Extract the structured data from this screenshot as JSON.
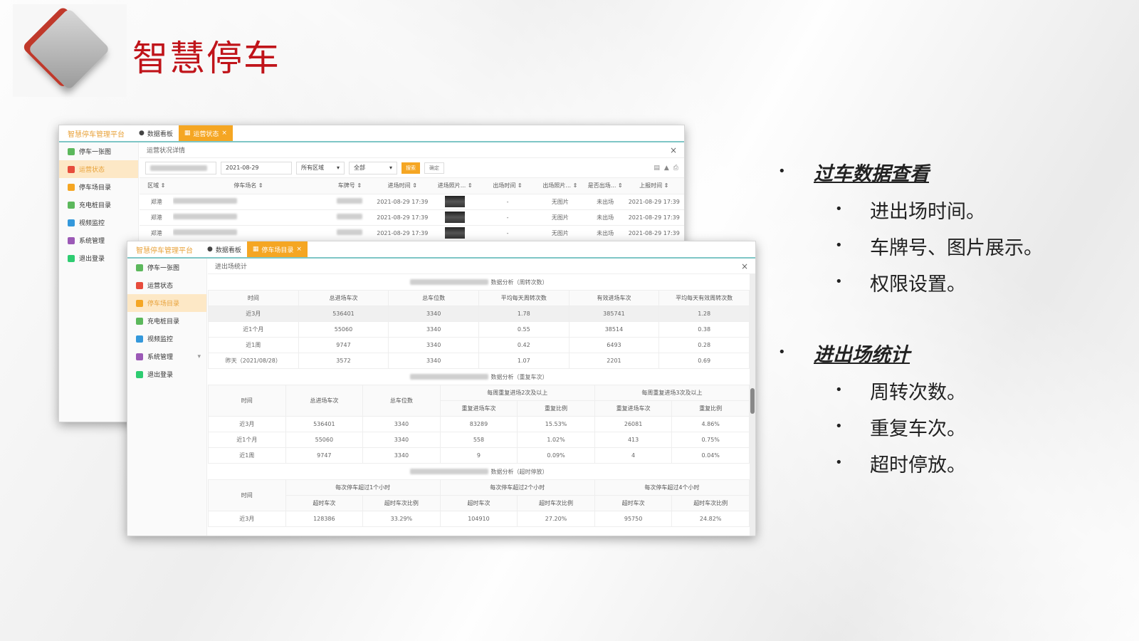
{
  "slide": {
    "title": "智慧停车"
  },
  "bullets": [
    {
      "heading": "过车数据查看",
      "items": [
        "进出场时间。",
        "车牌号、图片展示。",
        "权限设置。"
      ]
    },
    {
      "heading": "进出场统计",
      "items": [
        "周转次数。",
        "重复车次。",
        "超时停放。"
      ]
    }
  ],
  "back_window": {
    "brand": "智慧停车管理平台",
    "tabs": [
      "数据看板",
      "运营状态"
    ],
    "active_tab": 1,
    "tab_close": "×",
    "sidebar": [
      "停车一张图",
      "运营状态",
      "停车场目录",
      "充电桩目录",
      "视频监控",
      "系统管理",
      "退出登录"
    ],
    "active_sidebar": 1,
    "crumb": "运营状况详情",
    "close": "×",
    "filters": {
      "date": "2021-08-29",
      "region": "所有区域",
      "status": "全部",
      "search_btn": "搜索",
      "confirm_btn": "确定"
    },
    "columns": [
      "区域",
      "停车场名",
      "车牌号",
      "进场时间",
      "进场照片...",
      "出场时间",
      "出场照片...",
      "是否出场...",
      "上报时间"
    ],
    "rows": [
      {
        "area": "郑港",
        "enter": "2021-08-29 17:39",
        "exit": "-",
        "exit_photo": "无图片",
        "left": "未出场",
        "report": "2021-08-29 17:39"
      },
      {
        "area": "郑港",
        "enter": "2021-08-29 17:39",
        "exit": "-",
        "exit_photo": "无图片",
        "left": "未出场",
        "report": "2021-08-29 17:39"
      },
      {
        "area": "郑港",
        "enter": "2021-08-29 17:39",
        "exit": "-",
        "exit_photo": "无图片",
        "left": "未出场",
        "report": "2021-08-29 17:39"
      }
    ]
  },
  "front_window": {
    "brand": "智慧停车管理平台",
    "tabs": [
      "数据看板",
      "停车场目录"
    ],
    "active_tab": 1,
    "tab_close": "×",
    "sidebar": [
      "停车一张图",
      "运营状态",
      "停车场目录",
      "充电桩目录",
      "视频监控",
      "系统管理",
      "退出登录"
    ],
    "active_sidebar": 2,
    "crumb": "进出场统计",
    "close": "×",
    "turnover": {
      "title": "数据分析（周转次数）",
      "headers": [
        "时间",
        "总进场车次",
        "总车位数",
        "平均每天周转次数",
        "有效进场车次",
        "平均每天有效周转次数"
      ],
      "rows": [
        [
          "近3月",
          "536401",
          "3340",
          "1.78",
          "385741",
          "1.28"
        ],
        [
          "近1个月",
          "55060",
          "3340",
          "0.55",
          "38514",
          "0.38"
        ],
        [
          "近1周",
          "9747",
          "3340",
          "0.42",
          "6493",
          "0.28"
        ],
        [
          "昨天（2021/08/28）",
          "3572",
          "3340",
          "1.07",
          "2201",
          "0.69"
        ]
      ]
    },
    "repeat": {
      "title": "数据分析（重复车次）",
      "headers": [
        "时间",
        "总进场车次",
        "总车位数",
        "每周重复进场2次及以上",
        "每周重复进场3次及以上"
      ],
      "subheaders": [
        "重复进场车次",
        "重复比例",
        "重复进场车次",
        "重复比例"
      ],
      "rows": [
        [
          "近3月",
          "536401",
          "3340",
          "83289",
          "15.53%",
          "26081",
          "4.86%"
        ],
        [
          "近1个月",
          "55060",
          "3340",
          "558",
          "1.02%",
          "413",
          "0.75%"
        ],
        [
          "近1周",
          "9747",
          "3340",
          "9",
          "0.09%",
          "4",
          "0.04%"
        ]
      ]
    },
    "timeout": {
      "title": "数据分析（超时停放）",
      "headers": [
        "时间",
        "每次停车超过1个小时",
        "每次停车超过2个小时",
        "每次停车超过4个小时"
      ],
      "subheaders": [
        "超时车次",
        "超时车次比例",
        "超时车次",
        "超时车次比例",
        "超时车次",
        "超时车次比例"
      ],
      "rows": [
        [
          "近3月",
          "128386",
          "33.29%",
          "104910",
          "27.20%",
          "95750",
          "24.82%"
        ]
      ]
    }
  },
  "colors": {
    "accent": "#f5a623",
    "title_red": "#c0141a",
    "tab_line": "#7ec6c6"
  }
}
